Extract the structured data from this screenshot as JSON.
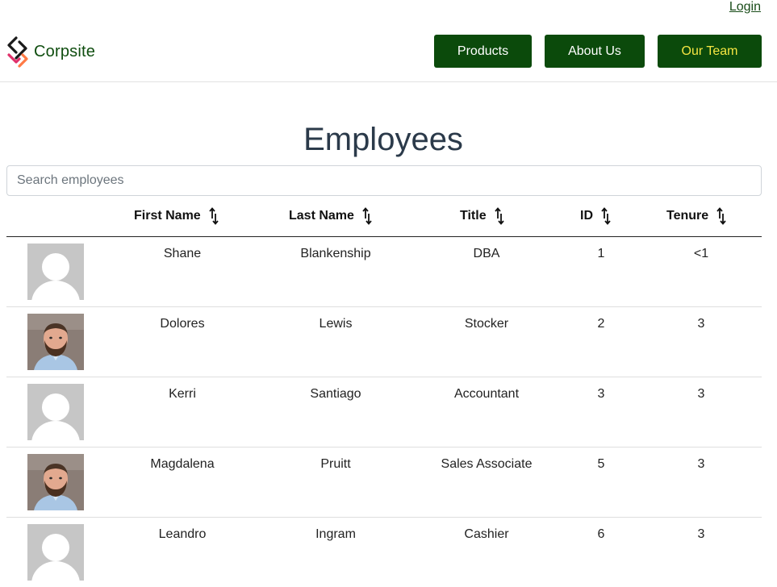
{
  "topbar": {
    "login_label": "Login"
  },
  "brand": {
    "name": "Corpsite"
  },
  "nav": {
    "products": "Products",
    "about": "About Us",
    "team": "Our Team"
  },
  "page": {
    "title": "Employees"
  },
  "search": {
    "placeholder": "Search employees",
    "value": ""
  },
  "table": {
    "columns": [
      "First Name",
      "Last Name",
      "Title",
      "ID",
      "Tenure"
    ],
    "rows": [
      {
        "avatar": "placeholder-avatar",
        "first": "Shane",
        "last": "Blankenship",
        "title": "DBA",
        "id": "1",
        "tenure": "<1"
      },
      {
        "avatar": "photo-avatar",
        "first": "Dolores",
        "last": "Lewis",
        "title": "Stocker",
        "id": "2",
        "tenure": "3"
      },
      {
        "avatar": "placeholder-avatar",
        "first": "Kerri",
        "last": "Santiago",
        "title": "Accountant",
        "id": "3",
        "tenure": "3"
      },
      {
        "avatar": "photo-avatar",
        "first": "Magdalena",
        "last": "Pruitt",
        "title": "Sales Associate",
        "id": "5",
        "tenure": "3"
      },
      {
        "avatar": "placeholder-avatar",
        "first": "Leandro",
        "last": "Ingram",
        "title": "Cashier",
        "id": "6",
        "tenure": "3"
      }
    ]
  },
  "colors": {
    "nav_bg": "#0b4a0b",
    "active_nav_text": "#f5e642",
    "title": "#2b3a4a",
    "placeholder_avatar": "#c6c6c6"
  }
}
